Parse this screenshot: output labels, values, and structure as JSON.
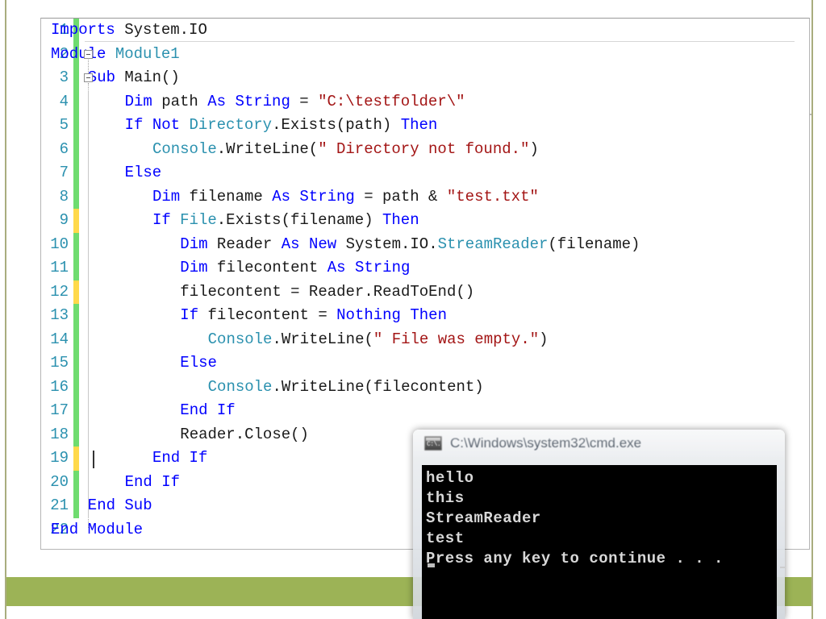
{
  "slide": {
    "accent_color": "#9cb356",
    "border_color": "#a9ad7e"
  },
  "editor": {
    "name": "visual-studio-code-editor",
    "language": "Visual Basic .NET",
    "syntax_colors": {
      "keyword": "#0000ff",
      "class": "#2b91af",
      "string": "#a31515",
      "plain": "#1a1a1a",
      "line_number": "#2b91af",
      "saved_change_bar": "#6fdc6f",
      "unsaved_change_bar": "#ffd94a"
    },
    "cursor_line": 19,
    "lines": [
      {
        "number": "1",
        "indent": 0,
        "change": "saved",
        "tokens": [
          {
            "t": "Imports",
            "c": "kw"
          },
          {
            "t": " System.IO",
            "c": "plain"
          }
        ]
      },
      {
        "number": "2",
        "indent": 0,
        "change": "saved",
        "tokens": [
          {
            "t": "Module",
            "c": "kw"
          },
          {
            "t": " ",
            "c": "plain"
          },
          {
            "t": "Module1",
            "c": "cls"
          }
        ]
      },
      {
        "number": "3",
        "indent": 4,
        "change": "saved",
        "tokens": [
          {
            "t": "Sub",
            "c": "kw"
          },
          {
            "t": " Main()",
            "c": "plain"
          }
        ]
      },
      {
        "number": "4",
        "indent": 8,
        "change": "saved",
        "tokens": [
          {
            "t": "Dim",
            "c": "kw"
          },
          {
            "t": " path ",
            "c": "plain"
          },
          {
            "t": "As",
            "c": "kw"
          },
          {
            "t": " ",
            "c": "plain"
          },
          {
            "t": "String",
            "c": "kw"
          },
          {
            "t": " = ",
            "c": "plain"
          },
          {
            "t": "\"C:\\testfolder\\\"",
            "c": "str"
          }
        ]
      },
      {
        "number": "5",
        "indent": 8,
        "change": "saved",
        "tokens": [
          {
            "t": "If",
            "c": "kw"
          },
          {
            "t": " ",
            "c": "plain"
          },
          {
            "t": "Not",
            "c": "kw"
          },
          {
            "t": " ",
            "c": "plain"
          },
          {
            "t": "Directory",
            "c": "cls"
          },
          {
            "t": ".Exists(path) ",
            "c": "plain"
          },
          {
            "t": "Then",
            "c": "kw"
          }
        ]
      },
      {
        "number": "6",
        "indent": 11,
        "change": "saved",
        "tokens": [
          {
            "t": "Console",
            "c": "cls"
          },
          {
            "t": ".WriteLine(",
            "c": "plain"
          },
          {
            "t": "\" Directory not found.\"",
            "c": "str"
          },
          {
            "t": ")",
            "c": "plain"
          }
        ]
      },
      {
        "number": "7",
        "indent": 8,
        "change": "saved",
        "tokens": [
          {
            "t": "Else",
            "c": "kw"
          }
        ]
      },
      {
        "number": "8",
        "indent": 11,
        "change": "saved",
        "tokens": [
          {
            "t": "Dim",
            "c": "kw"
          },
          {
            "t": " filename ",
            "c": "plain"
          },
          {
            "t": "As",
            "c": "kw"
          },
          {
            "t": " ",
            "c": "plain"
          },
          {
            "t": "String",
            "c": "kw"
          },
          {
            "t": " = path & ",
            "c": "plain"
          },
          {
            "t": "\"test.txt\"",
            "c": "str"
          }
        ]
      },
      {
        "number": "9",
        "indent": 11,
        "change": "unsaved",
        "tokens": [
          {
            "t": "If",
            "c": "kw"
          },
          {
            "t": " ",
            "c": "plain"
          },
          {
            "t": "File",
            "c": "cls"
          },
          {
            "t": ".Exists(filename) ",
            "c": "plain"
          },
          {
            "t": "Then",
            "c": "kw"
          }
        ]
      },
      {
        "number": "10",
        "indent": 14,
        "change": "saved",
        "tokens": [
          {
            "t": "Dim",
            "c": "kw"
          },
          {
            "t": " Reader ",
            "c": "plain"
          },
          {
            "t": "As",
            "c": "kw"
          },
          {
            "t": " ",
            "c": "plain"
          },
          {
            "t": "New",
            "c": "kw"
          },
          {
            "t": " System.IO.",
            "c": "plain"
          },
          {
            "t": "StreamReader",
            "c": "cls"
          },
          {
            "t": "(filename)",
            "c": "plain"
          }
        ]
      },
      {
        "number": "11",
        "indent": 14,
        "change": "saved",
        "tokens": [
          {
            "t": "Dim",
            "c": "kw"
          },
          {
            "t": " filecontent ",
            "c": "plain"
          },
          {
            "t": "As",
            "c": "kw"
          },
          {
            "t": " ",
            "c": "plain"
          },
          {
            "t": "String",
            "c": "kw"
          }
        ]
      },
      {
        "number": "12",
        "indent": 14,
        "change": "unsaved",
        "tokens": [
          {
            "t": "filecontent = Reader.ReadToEnd()",
            "c": "plain"
          }
        ]
      },
      {
        "number": "13",
        "indent": 14,
        "change": "saved",
        "tokens": [
          {
            "t": "If",
            "c": "kw"
          },
          {
            "t": " filecontent = ",
            "c": "plain"
          },
          {
            "t": "Nothing",
            "c": "kw"
          },
          {
            "t": " ",
            "c": "plain"
          },
          {
            "t": "Then",
            "c": "kw"
          }
        ]
      },
      {
        "number": "14",
        "indent": 17,
        "change": "saved",
        "tokens": [
          {
            "t": "Console",
            "c": "cls"
          },
          {
            "t": ".WriteLine(",
            "c": "plain"
          },
          {
            "t": "\" File was empty.\"",
            "c": "str"
          },
          {
            "t": ")",
            "c": "plain"
          }
        ]
      },
      {
        "number": "15",
        "indent": 14,
        "change": "saved",
        "tokens": [
          {
            "t": "Else",
            "c": "kw"
          }
        ]
      },
      {
        "number": "16",
        "indent": 17,
        "change": "saved",
        "tokens": [
          {
            "t": "Console",
            "c": "cls"
          },
          {
            "t": ".WriteLine(filecontent)",
            "c": "plain"
          }
        ]
      },
      {
        "number": "17",
        "indent": 14,
        "change": "saved",
        "tokens": [
          {
            "t": "End If",
            "c": "kw"
          }
        ]
      },
      {
        "number": "18",
        "indent": 14,
        "change": "saved",
        "tokens": [
          {
            "t": "Reader.Close()",
            "c": "plain"
          }
        ]
      },
      {
        "number": "19",
        "indent": 11,
        "change": "unsaved",
        "tokens": [
          {
            "t": "End If",
            "c": "kw"
          }
        ]
      },
      {
        "number": "20",
        "indent": 8,
        "change": "saved",
        "tokens": [
          {
            "t": "End If",
            "c": "kw"
          }
        ]
      },
      {
        "number": "21",
        "indent": 4,
        "change": "saved",
        "tokens": [
          {
            "t": "End Sub",
            "c": "kw"
          }
        ]
      },
      {
        "number": "22",
        "indent": 0,
        "change": "none",
        "tokens": [
          {
            "t": "End Module",
            "c": "kw"
          }
        ]
      }
    ]
  },
  "console": {
    "title": "C:\\Windows\\system32\\cmd.exe",
    "icon": "cmd-console-icon",
    "output": [
      "hello",
      "this",
      "StreamReader",
      "test",
      "Press any key to continue . . ."
    ]
  }
}
